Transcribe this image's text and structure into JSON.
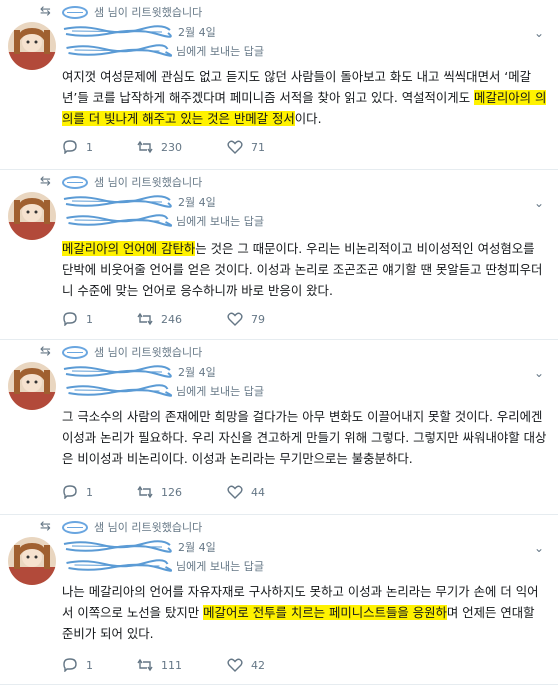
{
  "tweets": [
    {
      "retweet_by": "샘 님이 리트윗했습니다",
      "date": "2월 4일",
      "reply_to": "님에게 보내는 답글",
      "body": [
        {
          "text": "여지껏 여성문제에 관심도 없고 듣지도 않던 사람들이 돌아보고 화도 내고 씩씩대면서 ‘메갈년’들 코를 납작하게 해주겠다며 페미니즘 서적을 찾아 읽고 있다. 역설적이게도 ",
          "hl": false
        },
        {
          "text": "메갈리아의 의의를 더 빛나게 해주고 있는 것은 반메갈 정서",
          "hl": true
        },
        {
          "text": "이다.",
          "hl": false
        }
      ],
      "counts": {
        "reply": "1",
        "retweet": "230",
        "like": "71"
      }
    },
    {
      "retweet_by": "샘 님이 리트윗했습니다",
      "date": "2월 4일",
      "reply_to": "님에게 보내는 답글",
      "body": [
        {
          "text": "메갈리아의 언어에 감탄하",
          "hl": true
        },
        {
          "text": "는 것은 그 때문이다. 우리는 비논리적이고 비이성적인 여성혐오를 단박에 비웃어줄 언어를 얻은 것이다. 이성과 논리로 조곤조곤 얘기할 땐 못알듣고 딴청피우더니 수준에 맞는 언어로 응수하니까 바로 반응이 왔다.",
          "hl": false
        }
      ],
      "counts": {
        "reply": "1",
        "retweet": "246",
        "like": "79"
      }
    },
    {
      "retweet_by": "샘 님이 리트윗했습니다",
      "date": "2월 4일",
      "reply_to": "님에게 보내는 답글",
      "body": [
        {
          "text": "그 극소수의 사람의 존재에만 희망을 걸다가는 아무 변화도 이끌어내지 못할 것이다. 우리에겐 이성과 논리가 필요하다. 우리 자신을 견고하게 만들기 위해 그렇다. 그렇지만 싸워내야할 대상은 비이성과 비논리이다. 이성과 논리라는 무기만으로는 불충분하다.",
          "hl": false
        }
      ],
      "counts": {
        "reply": "1",
        "retweet": "126",
        "like": "44"
      }
    },
    {
      "retweet_by": "샘 님이 리트윗했습니다",
      "date": "2월 4일",
      "reply_to": "님에게 보내는 답글",
      "body": [
        {
          "text": "나는 메갈리아의 언어를 자유자재로 구사하지도 못하고 이성과 논리라는 무기가 손에 더 익어서 이쪽으로 노선을 탔지만 ",
          "hl": false
        },
        {
          "text": "메갈어로 전투를 치르는 페미니스트들을 응원하",
          "hl": true
        },
        {
          "text": "며 언제든 연대할 준비가 되어 있다.",
          "hl": false
        }
      ],
      "counts": {
        "reply": "1",
        "retweet": "111",
        "like": "42"
      }
    }
  ],
  "colors": {
    "highlight": "#fff200",
    "muted": "#657786",
    "scribble": "#5b9bd5"
  }
}
